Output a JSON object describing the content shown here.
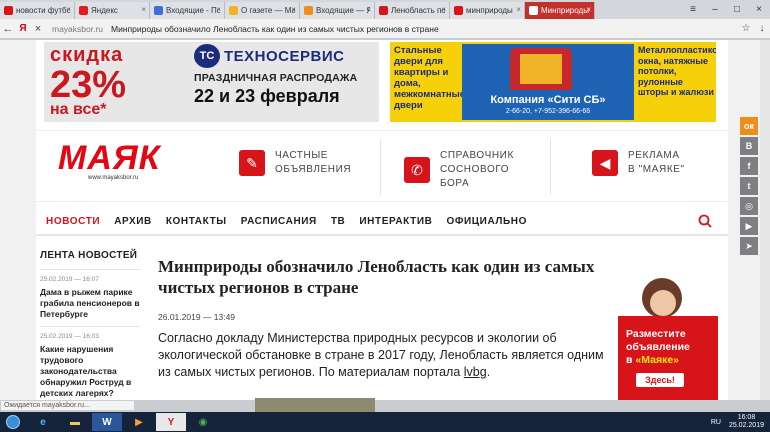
{
  "browser": {
    "tabs": [
      {
        "label": "новости футбо",
        "color": "#d7141a"
      },
      {
        "label": "Яндекс",
        "color": "#e31d1d"
      },
      {
        "label": "Входящие - Пс",
        "color": "#3b6fd8"
      },
      {
        "label": "О газете — Ма",
        "color": "#f0b328"
      },
      {
        "label": "Входящие — Я",
        "color": "#f08c1a"
      },
      {
        "label": "Ленобласть по",
        "color": "#d7141a"
      },
      {
        "label": "минприроды",
        "color": "#d7141a"
      },
      {
        "label": "Минприроды",
        "color": "#ffffff"
      }
    ],
    "url": "mayaksbor.ru",
    "page_title": "Минприроды обозначило Ленобласть как один из самых чистых регионов в стране",
    "status": "Ожидается mayaksbor.ru..."
  },
  "ad_top_left": {
    "skidka": "скидка",
    "percent": "23%",
    "navse": "на все*",
    "brand": "ТЕХНОСЕРВИС",
    "logo": "ТС",
    "promo": "ПРАЗДНИЧНАЯ РАСПРОДАЖА",
    "dates": "22 и 23 февраля"
  },
  "ad_top_right": {
    "left_text": "Стальные двери для квартиры и дома, межкомнатные двери",
    "company": "Компания «Сити СБ»",
    "phones": "2-66-20, +7-952-396-66-66",
    "right_text": "Металлопластиковые окна, натяжные потолки, рулонные шторы и жалюзи"
  },
  "header": {
    "logo": "МАЯК",
    "site": "www.mayaksbor.ru",
    "items": [
      {
        "line1": "ЧАСТНЫЕ",
        "line2": "ОБЪЯВЛЕНИЯ"
      },
      {
        "line1": "СПРАВОЧНИК",
        "line2": "СОСНОВОГО БОРА"
      },
      {
        "line1": "РЕКЛАМА",
        "line2": "В \"МАЯКЕ\""
      }
    ]
  },
  "nav": [
    "НОВОСТИ",
    "АРХИВ",
    "КОНТАКТЫ",
    "РАСПИСАНИЯ",
    "ТВ",
    "ИНТЕРАКТИВ",
    "ОФИЦИАЛЬНО"
  ],
  "news": {
    "heading": "ЛЕНТА НОВОСТЕЙ",
    "items": [
      {
        "date": "25.02.2019 — 16:07",
        "title": "Дама в рыжем парике грабила пенсионеров в Петербурге"
      },
      {
        "date": "25.02.2019 — 16:03",
        "title": "Какие нарушения трудового законодательства обнаружил Роструд в детских лагерях?"
      }
    ]
  },
  "article": {
    "title": "Минприроды обозначило Ленобласть как один из самых чистых регионов в стране",
    "date": "26.01.2019 — 13:49",
    "body": "Согласно докладу Министерства природных ресурсов и экологии об экологической обстановке в стране в 2017 году, Ленобласть является одним из самых чистых регионов. По материалам портала ",
    "link": "lvbg",
    "end": "."
  },
  "side_ad": {
    "line1": "Разместите",
    "line2": "объявление",
    "line3": "в",
    "line3b": "«Маяке»",
    "button": "Здесь!"
  },
  "share": [
    "ok",
    "B",
    "f",
    "t",
    "in",
    "yt",
    "tg"
  ],
  "taskbar": {
    "items": [
      "IE",
      "Explorer",
      "Word",
      "Yandex",
      "Media",
      "Y",
      "Chrome"
    ],
    "lang": "RU",
    "date": "25.02.2019",
    "time": "16:08"
  }
}
